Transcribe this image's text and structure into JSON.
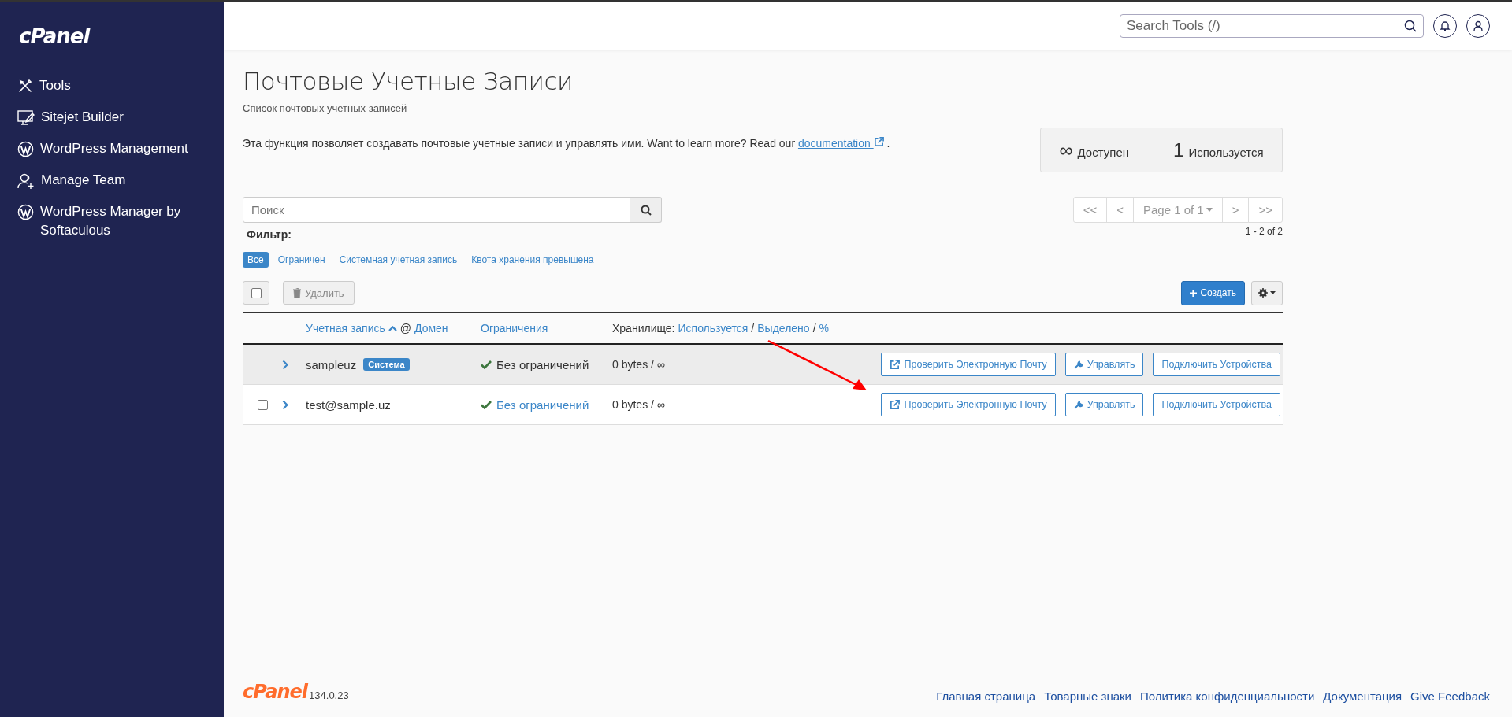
{
  "sidebar": {
    "logo": "cPanel",
    "items": [
      {
        "label": "Tools",
        "kind": "tools"
      },
      {
        "label": "Sitejet Builder",
        "kind": "monitor"
      },
      {
        "label": "WordPress Management",
        "kind": "wp"
      },
      {
        "label": "Manage Team",
        "kind": "team"
      },
      {
        "label": "WordPress Manager by Softaculous",
        "kind": "wp"
      }
    ]
  },
  "topbar": {
    "search": {
      "placeholder": "Search Tools (/)"
    }
  },
  "page": {
    "title": "Почтовые Учетные Записи",
    "subtitle": "Список почтовых учетных записей",
    "description": "Эта функция позволяет создавать почтовые учетные записи и управлять ими. Want to learn more? Read our",
    "doc_link": "documentation",
    "description_end": "."
  },
  "stats": [
    {
      "value": "∞",
      "label": "Доступен"
    },
    {
      "value": "1",
      "label": "Используется"
    }
  ],
  "search": {
    "placeholder": "Поиск"
  },
  "pagination": {
    "first": "<<",
    "prev": "<",
    "page": "Page 1 of 1",
    "next": ">",
    "last": ">>",
    "range": "1 - 2 of 2"
  },
  "filter": {
    "label": "Фильтр:",
    "options": [
      {
        "label": "Все",
        "selected": true
      },
      {
        "label": "Ограничен",
        "selected": false
      },
      {
        "label": "Системная учетная запись",
        "selected": false
      },
      {
        "label": "Квота хранения превышена",
        "selected": false
      }
    ]
  },
  "toolbar": {
    "select_all": {
      "checked": false
    },
    "delete": {
      "label": "Удалить",
      "disabled": true
    },
    "create": "Создать"
  },
  "table": {
    "columns": [
      {
        "parts": [
          {
            "text": "Учетная запись",
            "link": true,
            "sorted": true
          },
          {
            "text": "@",
            "link": false
          },
          {
            "text": "Домен",
            "link": true
          }
        ]
      },
      {
        "parts": [
          {
            "text": "Ограничения",
            "link": true
          }
        ]
      },
      {
        "parts": [
          {
            "text": "Хранилище:",
            "link": false
          },
          {
            "text": "Используется",
            "link": true
          },
          {
            "text": "/",
            "link": false
          },
          {
            "text": "Выделено",
            "link": true
          },
          {
            "text": "/",
            "link": false
          },
          {
            "text": "%",
            "link": true
          }
        ]
      }
    ],
    "rows": [
      {
        "account": "sampleuz",
        "badge": "Система",
        "highlighted": true,
        "restriction": "Без ограничений",
        "restriction_link": false,
        "storage": "0 bytes / ∞",
        "actions": [
          {
            "label": "Проверить Электронную Почту",
            "kind": "external"
          },
          {
            "label": "Управлять",
            "kind": "wrench"
          },
          {
            "label": "Подключить Устройства",
            "kind": "plain"
          }
        ]
      },
      {
        "account": "test@sample.uz",
        "checkbox": {
          "checked": false
        },
        "highlighted": false,
        "restriction": "Без ограничений",
        "restriction_link": true,
        "storage": "0 bytes / ∞",
        "actions": [
          {
            "label": "Проверить Электронную Почту",
            "kind": "external"
          },
          {
            "label": "Управлять",
            "kind": "wrench"
          },
          {
            "label": "Подключить Устройства",
            "kind": "plain"
          }
        ]
      }
    ]
  },
  "annotation_arrow": true,
  "footer": {
    "logo": "cPanel",
    "version": "134.0.23",
    "links": [
      "Главная страница",
      "Товарные знаки",
      "Политика конфиденциальности",
      "Документация",
      "Give Feedback"
    ]
  }
}
